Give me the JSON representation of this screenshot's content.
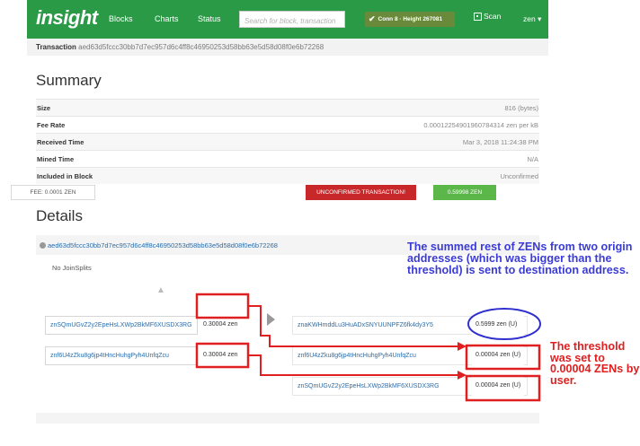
{
  "navbar": {
    "brand": "insight",
    "links": [
      "Blocks",
      "Charts",
      "Status"
    ],
    "search_placeholder": "Search for block, transaction",
    "connection": "Conn 8 · Height 267081",
    "scan_label": "Scan",
    "currency": "zen ▾",
    "icons": [
      "check-icon",
      "qr-code-icon",
      "caret-down-icon"
    ]
  },
  "transaction": {
    "label": "Transaction",
    "hash": "aed63d5fccc30bb7d7ec957d6c4ff8c46950253d58bb63e5d58d08f0e6b72268"
  },
  "summary": {
    "title": "Summary",
    "rows": [
      {
        "key": "Size",
        "value": "816 (bytes)"
      },
      {
        "key": "Fee Rate",
        "value": "0.00012254901960784314 zen per kB"
      },
      {
        "key": "Received Time",
        "value": "Mar 3, 2018 11:24:38 PM"
      },
      {
        "key": "Mined Time",
        "value": "N/A"
      },
      {
        "key": "Included in Block",
        "value": "Unconfirmed"
      }
    ]
  },
  "details": {
    "title": "Details",
    "tx_hash": "aed63d5fccc30bb7d7ec957d6c4ff8c46950253d58bb63e5d58d08f0e6b72268",
    "no_joinsplits": "No JoinSplits",
    "inputs": [
      {
        "address": "znSQmUGvZ2y2EpeHsLXWp2BkMF6XUSDX3RG",
        "amount": "0.30004 zen"
      },
      {
        "address": "znf6U4zZku8g6jp4tHncHuhgPyh4UnfqZcu",
        "amount": "0.30004 zen"
      }
    ],
    "outputs": [
      {
        "address": "znaKWHmddLu3HuADxSNYUUNPFZ6fk4dy3Y5",
        "amount": "0.5999 zen (U)"
      },
      {
        "address": "znf6U4zZku8g6jp4tHncHuhgPyh4UnfqZcu",
        "amount": "0.00004 zen (U)"
      },
      {
        "address": "znSQmUGvZ2y2EpeHsLXWp2BkMF6XUSDX3RG",
        "amount": "0.00004 zen (U)"
      }
    ],
    "fee": "FEE: 0.0001 ZEN",
    "status": "UNCONFIRMED TRANSACTION!",
    "total": "0.59998 ZEN"
  },
  "annotations": {
    "blue": "The summed rest of ZENs from two origin addresses (which was bigger than the threshold) is sent to destination address.",
    "red": "The threshold was set to 0.00004 ZENs by user."
  },
  "colors": {
    "nav_green": "#2b9a47",
    "annotation_red": "#e02020",
    "annotation_blue": "#3b3bd6",
    "status_red": "#c9282a",
    "total_green": "#5bb74a",
    "link_blue": "#2a6dab"
  }
}
